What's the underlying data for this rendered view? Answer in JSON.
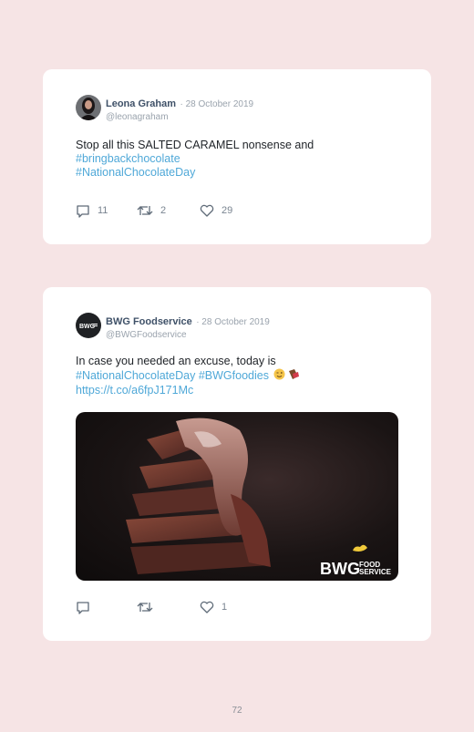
{
  "tweets": [
    {
      "name": "Leona Graham",
      "date": "· 28 October 2019",
      "handle": "@leonagraham",
      "text": "Stop all this SALTED CARAMEL nonsense and",
      "hashtag1": "#bringbackchocolate",
      "hashtag2": "#NationalChocolateDay",
      "reply_count": "11",
      "retweet_count": "2",
      "like_count": "29"
    },
    {
      "name": "BWG Foodservice",
      "date": "· 28 October 2019",
      "handle": "@BWGFoodservice",
      "text": "In case you needed an excuse, today is",
      "hashtag1": "#NationalChocolateDay",
      "hashtag2": "#BWGfoodies",
      "url": "https://t.co/a6fpJ171Mc",
      "like_count": "1",
      "image_logo_main": "BWG",
      "image_logo_sub1": "FOOD",
      "image_logo_sub2": "SERVICE",
      "avatar_logo": "BWG"
    }
  ],
  "page_number": "72",
  "colors": {
    "background": "#f6e4e5",
    "link": "#4fa8d8",
    "name": "#3f5168"
  }
}
